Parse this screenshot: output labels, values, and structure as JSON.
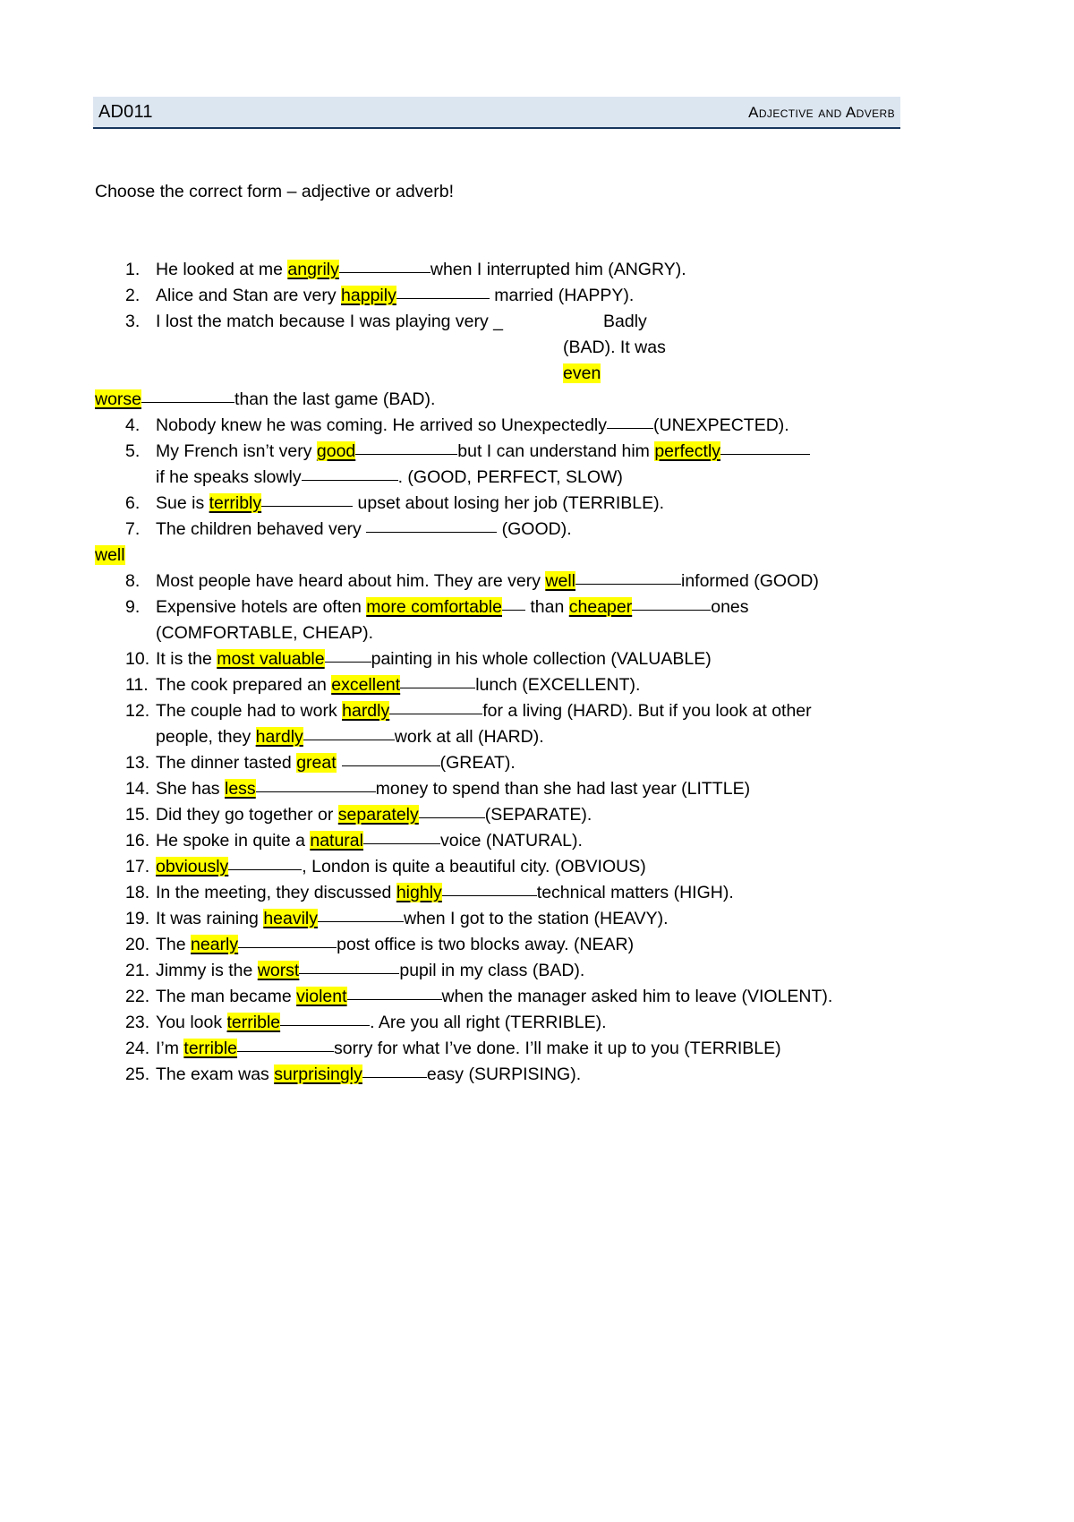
{
  "header": {
    "code": "AD011",
    "title": "Adjective and Adverb"
  },
  "instruction": "Choose the correct form – adjective or adverb!",
  "items": {
    "n1": "1.",
    "n2": "2.",
    "n3": "3.",
    "n4": "4.",
    "n5": "5.",
    "n6": "6.",
    "n7": "7.",
    "n8": "8.",
    "n9": "9.",
    "n10": "10.",
    "n11": "11.",
    "n12": "12.",
    "n13": "13.",
    "n14": "14.",
    "n15": "15.",
    "n16": "16.",
    "n17": "17.",
    "n18": "18.",
    "n19": "19.",
    "n20": "20.",
    "n21": "21.",
    "n22": "22.",
    "n23": "23.",
    "n24": "24.",
    "n25": "25."
  },
  "q1": {
    "pre": "He looked at me ",
    "answer": "angrily",
    "post": "when I interrupted him (ANGRY)."
  },
  "q2": {
    "pre": "Alice and Stan are very ",
    "answer": "happily",
    "post": " married  (HAPPY)."
  },
  "q3": {
    "pre": "I lost the match because I was playing very _",
    "answer1": "Badly",
    "mid": "(BAD). It was",
    "answer2": "even",
    "answer3": "worse",
    "post": "than the last game (BAD)."
  },
  "q4": {
    "pre": "Nobody knew he was coming. He arrived so Unexpectedly",
    "post": "(UNEXPECTED)."
  },
  "q5": {
    "pre": "My French isn’t very ",
    "answer1": "good",
    "mid": "but I can understand him ",
    "answer2": "perfectly",
    "line2pre": "if he speaks slowly",
    "post": ". (GOOD, PERFECT, SLOW)"
  },
  "q6": {
    "pre": "Sue is ",
    "answer": "terribly",
    "post": " upset about losing her job (TERRIBLE)."
  },
  "q7": {
    "pre": "The children behaved very ",
    "post": " (GOOD).",
    "answer": "well"
  },
  "q8": {
    "pre": "Most people have heard about him. They are very ",
    "answer": "well",
    "post": "informed (GOOD)"
  },
  "q9": {
    "pre": "Expensive hotels are often ",
    "answer1": "more comfortable",
    "mid": " than ",
    "answer2": "cheaper",
    "post": "ones",
    "line2": "(COMFORTABLE, CHEAP)."
  },
  "q10": {
    "pre": "It is the ",
    "answer": "most valuable",
    "post": "painting in his whole collection (VALUABLE)"
  },
  "q11": {
    "pre": "The cook prepared an ",
    "answer": "excellent",
    "post": "lunch (EXCELLENT)."
  },
  "q12": {
    "pre": "The couple had to work ",
    "answer1": "hardly",
    "mid": "for a living (HARD). But if you look at other",
    "line2pre": "people, they ",
    "answer2": "hardly",
    "post": "work at all (HARD)."
  },
  "q13": {
    "pre": "The dinner tasted ",
    "answer": "great",
    "post": "(GREAT)."
  },
  "q14": {
    "pre": "She has ",
    "answer": "less",
    "post": "money to spend than she had last year (LITTLE)"
  },
  "q15": {
    "pre": "Did they go together or ",
    "answer": "separately",
    "post": "(SEPARATE)."
  },
  "q16": {
    "pre": "He spoke in quite a ",
    "answer": "natural",
    "post": "voice (NATURAL)."
  },
  "q17": {
    "pre": " ",
    "answer": "obviously",
    "post": ", London is quite a beautiful city. (OBVIOUS)"
  },
  "q18": {
    "pre": "In the meeting, they discussed ",
    "answer": "highly",
    "post": "technical matters (HIGH)."
  },
  "q19": {
    "pre": "It was raining ",
    "answer": "heavily",
    "post": "when I got to the station (HEAVY)."
  },
  "q20": {
    "pre": "The ",
    "answer": "nearly",
    "post": "post office is two blocks away. (NEAR)"
  },
  "q21": {
    "pre": "Jimmy is the ",
    "answer": "worst",
    "post": "pupil in my class (BAD)."
  },
  "q22": {
    "pre": "The man became ",
    "answer": "violent",
    "post": "when the manager asked him to leave (VIOLENT)."
  },
  "q23": {
    "pre": "You look ",
    "answer": "terrible",
    "post": ". Are you all right (TERRIBLE)."
  },
  "q24": {
    "pre": "I’m ",
    "answer": "terrible",
    "post": "sorry for what I’ve done.  I’ll make it up to you (TERRIBLE)"
  },
  "q25": {
    "pre": "The exam was ",
    "answer": "surprisingly",
    "post": "easy (SURPISING)."
  },
  "colors": {
    "header_band": "#dce6f1",
    "header_rule": "#17365d",
    "highlight": "#ffff00"
  }
}
